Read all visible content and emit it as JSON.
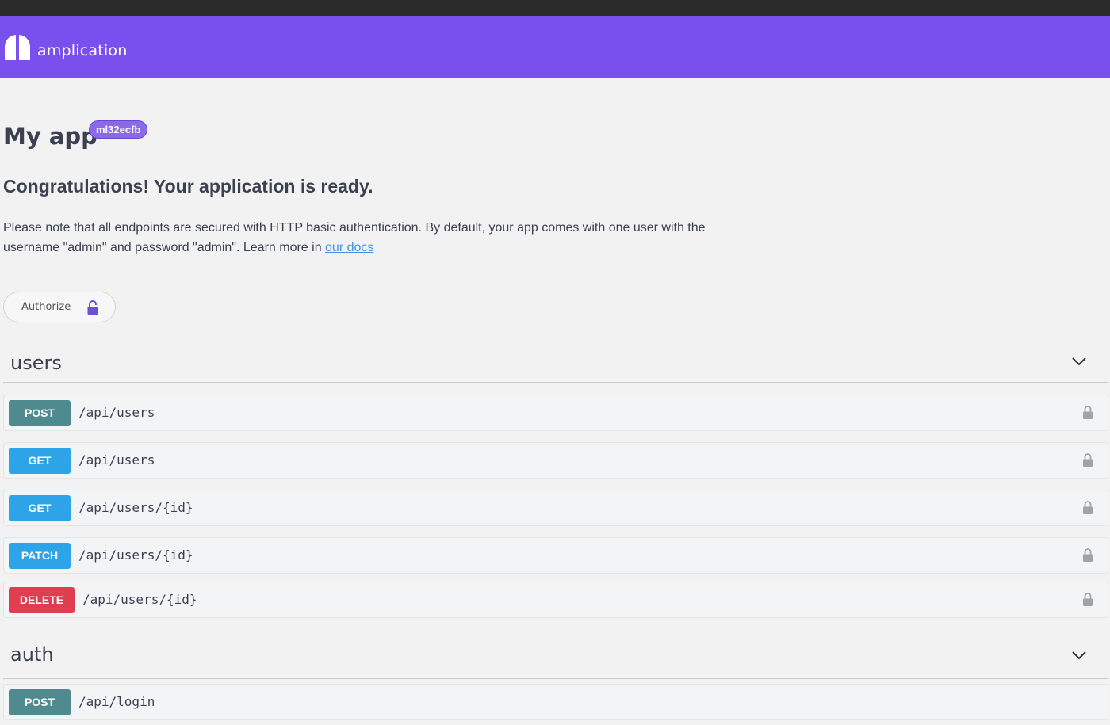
{
  "header": {
    "brand": "amplication",
    "brand_color": "#7950ed"
  },
  "info": {
    "title": "My app",
    "version": "ml32ecfb",
    "congrats": "Congratulations! Your application is ready.",
    "desc_text": "Please note that all endpoints are secured with HTTP basic authentication. By default, your app comes with one user with the username \"admin\" and password \"admin\". Learn more in ",
    "docs_link": "our docs"
  },
  "authorize": {
    "label": "Authorize",
    "icon": "lock-icon"
  },
  "sections": [
    {
      "name": "users",
      "icon": "chevron-down-icon",
      "operations": [
        {
          "method": "POST",
          "path": "/api/users",
          "color": "#4f8b8e"
        },
        {
          "method": "GET",
          "path": "/api/users",
          "color": "#2ea4e8"
        },
        {
          "method": "GET",
          "path": "/api/users/{id}",
          "color": "#2ea4e8"
        },
        {
          "method": "PATCH",
          "path": "/api/users/{id}",
          "color": "#2ea4e8"
        },
        {
          "method": "DELETE",
          "path": "/api/users/{id}",
          "color": "#de3e4f"
        }
      ]
    },
    {
      "name": "auth",
      "icon": "chevron-down-icon",
      "operations": [
        {
          "method": "POST",
          "path": "/api/login",
          "color": "#4f8b8e"
        }
      ]
    }
  ]
}
